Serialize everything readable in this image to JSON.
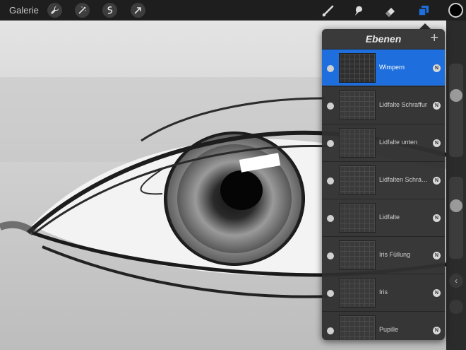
{
  "toolbar": {
    "gallery_label": "Galerie",
    "left_tools": [
      "wrench-icon",
      "magic-wand-icon",
      "selection-icon",
      "transform-arrow-icon"
    ],
    "right_tools": [
      "brush-icon",
      "smudge-icon",
      "eraser-icon",
      "layers-icon"
    ],
    "accent_color": "#1e6fdd",
    "current_color": "#000000"
  },
  "layers_panel": {
    "title": "Ebenen",
    "add_label": "+",
    "layers": [
      {
        "name": "Wimpern",
        "blend": "N",
        "active": true
      },
      {
        "name": "Lidfalte Schraffur",
        "blend": "N",
        "active": false
      },
      {
        "name": "Lidfalte unten",
        "blend": "N",
        "active": false
      },
      {
        "name": "Lidfalten Schraffur",
        "blend": "N",
        "active": false
      },
      {
        "name": "Lidfalte",
        "blend": "N",
        "active": false
      },
      {
        "name": "Iris Füllung",
        "blend": "N",
        "active": false
      },
      {
        "name": "Iris",
        "blend": "N",
        "active": false
      },
      {
        "name": "Pupille",
        "blend": "N",
        "active": false
      }
    ]
  },
  "sidebar": {
    "collapse_label": "‹"
  }
}
